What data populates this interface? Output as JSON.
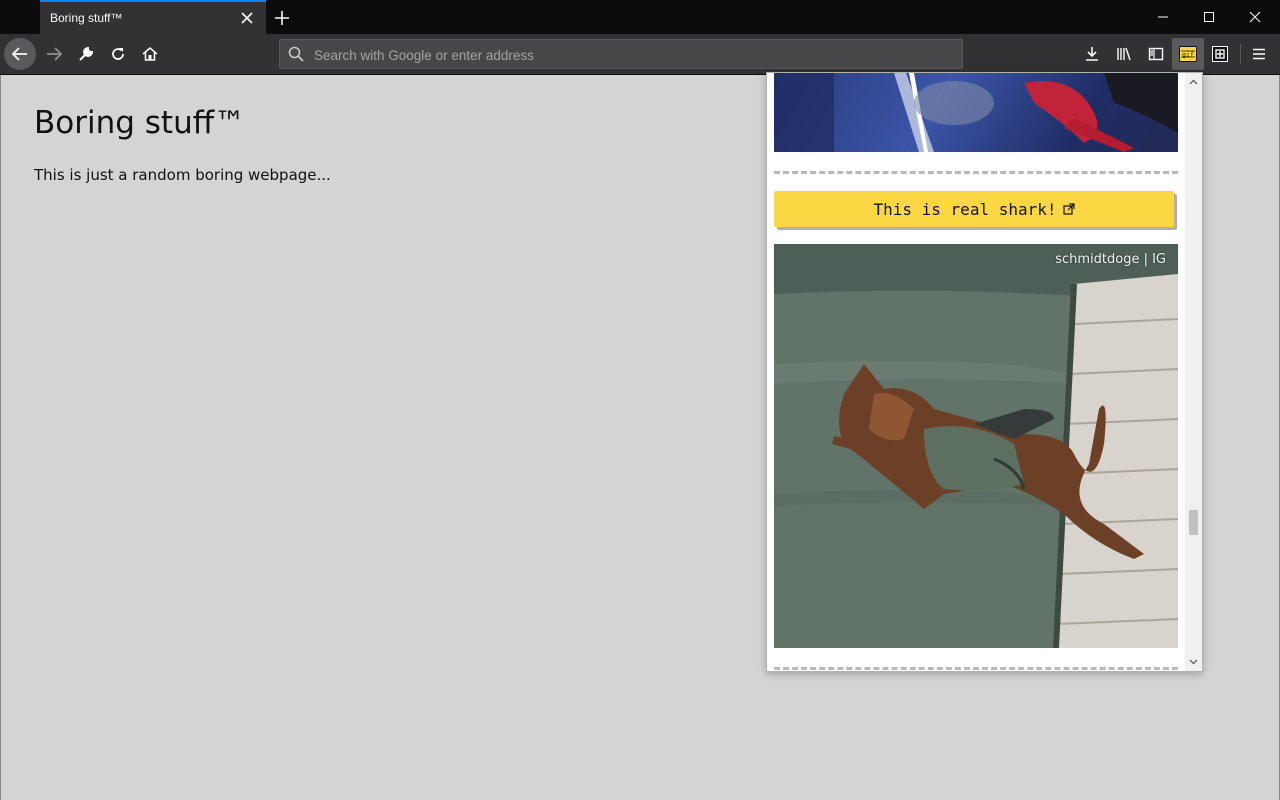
{
  "browser": {
    "tab": {
      "title": "Boring stuff™"
    },
    "urlbar": {
      "placeholder": "Search with Google or enter address",
      "value": ""
    }
  },
  "page": {
    "heading": "Boring stuff™",
    "text": "This is just a random boring webpage..."
  },
  "popup": {
    "link_button_label": "This is real shark!",
    "gif_caption": "schmidtdoge | IG",
    "scroll_position": 0.78
  },
  "icons": {
    "toolbar": [
      "back-arrow-icon",
      "forward-arrow-icon",
      "wrench-icon",
      "reload-icon",
      "home-icon",
      "search-icon",
      "download-icon",
      "library-icon",
      "sidebar-icon",
      "gif-extension-icon",
      "extension-icon",
      "hamburger-menu-icon"
    ],
    "window": [
      "minimize-icon",
      "maximize-icon",
      "close-icon"
    ]
  },
  "colors": {
    "tab_accent": "#0a84ff",
    "toolbar_bg": "#323234",
    "tabstrip_bg": "#0c0c0d",
    "page_bg": "#d4d4d4",
    "popup_button": "#fbd843"
  }
}
